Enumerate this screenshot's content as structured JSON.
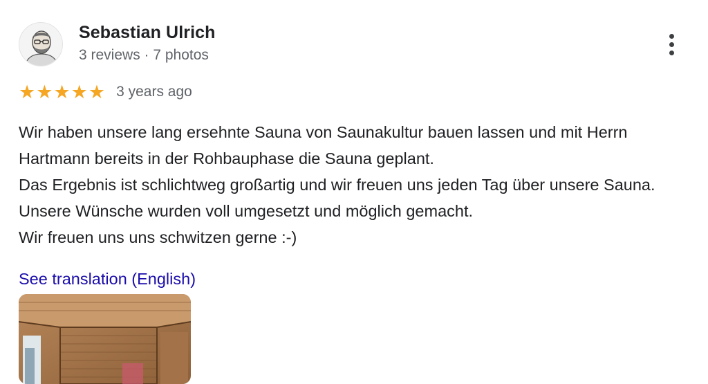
{
  "review": {
    "author_name": "Sebastian Ulrich",
    "author_meta": "3 reviews · 7 photos",
    "rating": 5,
    "rating_max": 5,
    "star_color": "#f5a623",
    "time_ago": "3 years ago",
    "text_lines": [
      "Wir haben unsere lang ersehnte Sauna von Saunakultur bauen lassen und mit Herrn Hartmann bereits in der Rohbauphase die Sauna geplant.",
      "Das Ergebnis ist schlichtweg großartig und wir freuen uns jeden Tag über unsere Sauna. Unsere Wünsche wurden voll umgesetzt und möglich gemacht.",
      "Wir freuen uns uns schwitzen gerne :-)"
    ],
    "translation_link": "See translation (English)",
    "icons": {
      "more": "more-vert-icon",
      "star": "star-icon"
    },
    "link_color": "#1a0dab"
  }
}
